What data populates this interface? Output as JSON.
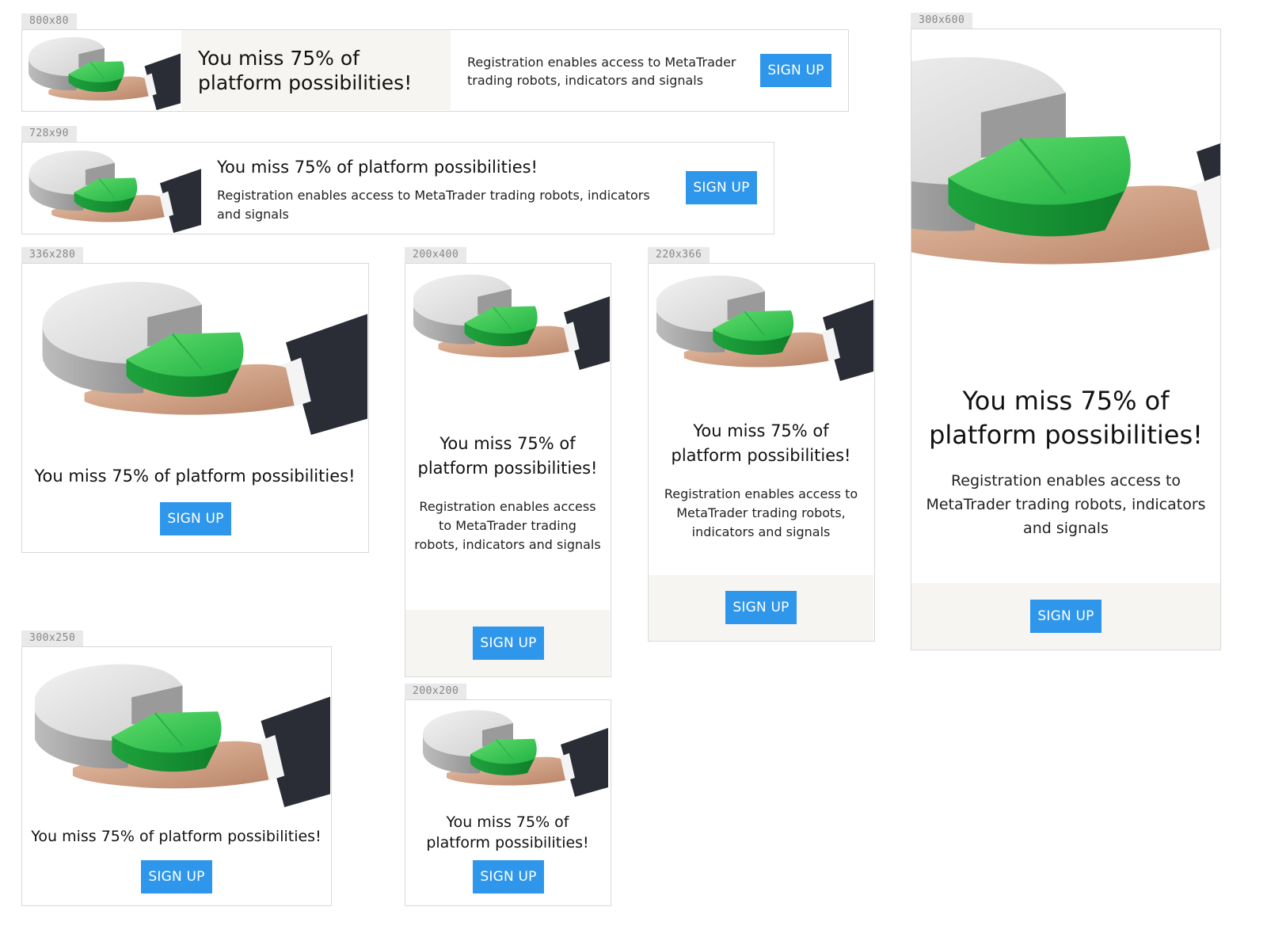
{
  "colors": {
    "button": "#2f97eb",
    "button_text": "#ffffff",
    "panel": "#f6f5f2",
    "border": "#d9d9d9",
    "tag_bg": "#e9e9e9",
    "tag_text": "#888888"
  },
  "icons": {
    "banner_art": "hand-holding-pie-chart-icon"
  },
  "banners": {
    "b800x80": {
      "size": "800x80",
      "headline_1": "You miss 75% of",
      "headline_2": "platform possibilities!",
      "body_1": "Registration enables access to MetaTrader",
      "body_2": "trading robots, indicators and signals",
      "button": "SIGN UP"
    },
    "b728x90": {
      "size": "728x90",
      "headline": "You miss 75% of platform possibilities!",
      "body_1": "Registration enables access to MetaTrader trading robots, indicators",
      "body_2": "and signals",
      "button": "SIGN UP"
    },
    "b336x280": {
      "size": "336x280",
      "headline": "You miss 75% of platform possibilities!",
      "button": "SIGN UP"
    },
    "b200x400": {
      "size": "200x400",
      "headline_1": "You miss 75% of",
      "headline_2": "platform possibilities!",
      "body_1": "Registration enables access",
      "body_2": "to MetaTrader trading",
      "body_3": "robots, indicators and signals",
      "button": "SIGN UP"
    },
    "b220x366": {
      "size": "220x366",
      "headline_1": "You miss 75% of",
      "headline_2": "platform possibilities!",
      "body_1": "Registration enables access to",
      "body_2": "MetaTrader trading robots,",
      "body_3": "indicators and signals",
      "button": "SIGN UP"
    },
    "b300x600": {
      "size": "300x600",
      "headline_1": "You miss 75% of",
      "headline_2": "platform possibilities!",
      "body_1": "Registration enables access to",
      "body_2": "MetaTrader trading robots, indicators",
      "body_3": "and signals",
      "button": "SIGN UP"
    },
    "b300x250": {
      "size": "300x250",
      "headline": "You miss 75% of platform possibilities!",
      "button": "SIGN UP"
    },
    "b200x200": {
      "size": "200x200",
      "headline_1": "You miss 75% of",
      "headline_2": "platform possibilities!",
      "button": "SIGN UP"
    }
  }
}
